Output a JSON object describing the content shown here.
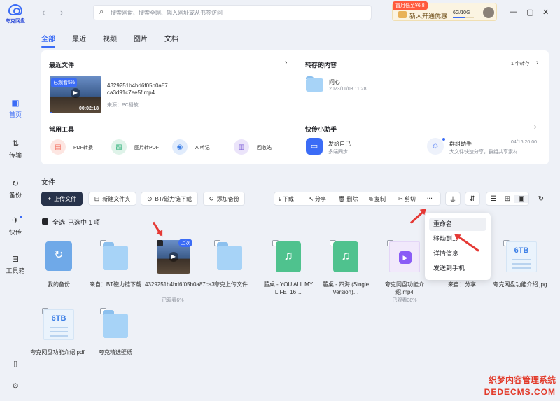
{
  "app": {
    "name": "夸克网盘",
    "brand_color": "#3b6cf6"
  },
  "sidebar": {
    "items": [
      {
        "label": "首页",
        "icon": "home-icon",
        "active": true
      },
      {
        "label": "传输",
        "icon": "transfer-icon"
      },
      {
        "label": "备份",
        "icon": "backup-icon"
      },
      {
        "label": "快传",
        "icon": "quick-send-icon"
      },
      {
        "label": "工具箱",
        "icon": "toolbox-icon"
      }
    ],
    "bottom_icons": [
      "phone-icon",
      "settings-icon"
    ]
  },
  "search": {
    "placeholder": "搜索网盘、搜索全网、输入网址或从书签访问"
  },
  "promo": {
    "tag": "首月低至¥6.8",
    "text": "新人开通优惠",
    "storage": "6G/10G",
    "storage_used_fraction": 0.6
  },
  "tabs": [
    "全部",
    "最近",
    "视频",
    "图片",
    "文档"
  ],
  "recent": {
    "title": "最近文件",
    "file_name_line1": "4329251b4bd6f05b0a87",
    "file_name_line2": "ca3d91c7ee5f.mp4",
    "source": "来源：PC播放",
    "badge": "已观看5%",
    "duration": "00:02:18"
  },
  "saved": {
    "title": "转存的内容",
    "count": "1 个转存",
    "item_name": "问心",
    "item_time": "2023/11/03 11:28"
  },
  "tools": {
    "title": "常用工具",
    "items": [
      {
        "label": "PDF转换",
        "icon": "pdf-convert-icon",
        "color": "#f26b5b"
      },
      {
        "label": "图片转PDF",
        "icon": "image-to-pdf-icon",
        "color": "#36b37e"
      },
      {
        "label": "AI听记",
        "icon": "ai-listen-icon",
        "color": "#3b7ee6"
      },
      {
        "label": "回收站",
        "icon": "recycle-bin-icon",
        "color": "#7b5cd6"
      }
    ]
  },
  "helper": {
    "title": "快传小助手",
    "self_title": "发给自己",
    "self_sub": "多端同步",
    "group_title": "群组助手",
    "group_sub": "大文件快速分享，群组共享素材…",
    "group_date": "04/16 20:00"
  },
  "files": {
    "title": "文件",
    "selection": {
      "all": "全选",
      "selected": "已选中 1 项"
    },
    "buttons": {
      "upload": "上传文件",
      "new_folder": "新建文件夹",
      "bt": "BT/磁力链下载",
      "add_backup": "添加备份"
    },
    "actions": {
      "download": "下载",
      "share": "分享",
      "delete": "删除",
      "copy": "复制",
      "cut": "剪切",
      "more": "···"
    },
    "items": [
      {
        "name": "我的备份",
        "type": "backup"
      },
      {
        "name": "来自：BT磁力链下载",
        "type": "folder"
      },
      {
        "name": "4329251b4bd6f05b0a87ca3…",
        "sub": "已观看6%",
        "type": "video",
        "badge": "上次",
        "checked": true
      },
      {
        "name": "夸克上传文件",
        "type": "folder"
      },
      {
        "name": "麓桌 - YOU ALL MY LIFE_16…",
        "type": "music"
      },
      {
        "name": "麓桌 - 四海 (Single Version)…",
        "type": "music"
      },
      {
        "name": "夸克网盘功能介绍.mp4",
        "sub": "已观看38%",
        "type": "video2"
      },
      {
        "name": "来自：分享",
        "type": "folder"
      },
      {
        "name": "夸克网盘功能介绍.jpg",
        "type": "doc"
      },
      {
        "name": "夸克网盘功能介绍.pdf",
        "type": "doc"
      },
      {
        "name": "夸克精选壁纸",
        "type": "folder"
      }
    ],
    "doc_thumb_text": "6TB"
  },
  "context_menu": {
    "items": [
      "重命名",
      "移动到...",
      "详情信息",
      "发送到手机"
    ]
  },
  "watermark": {
    "line1": "织梦内容管理系统",
    "line2": "DEDECMS.COM"
  }
}
